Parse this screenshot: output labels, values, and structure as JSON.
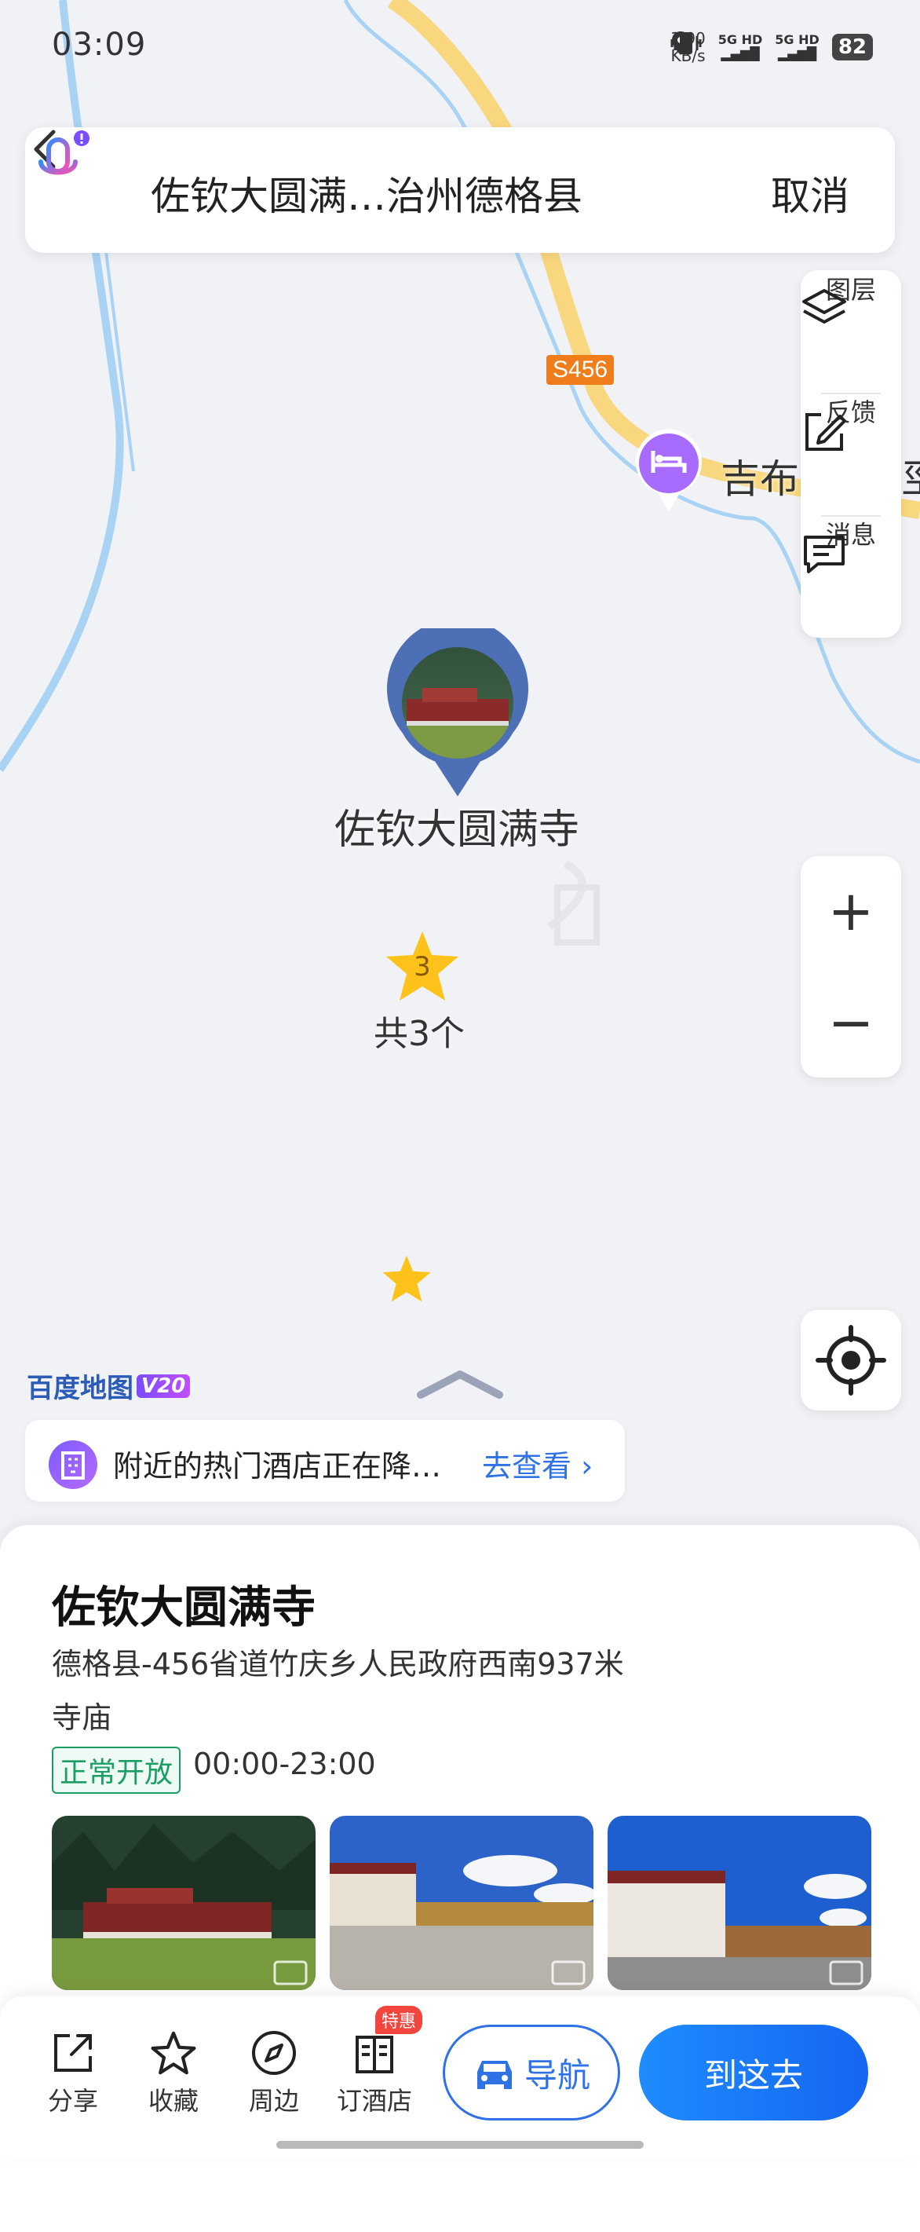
{
  "status_bar": {
    "time": "03:09",
    "net_speed_value": "3.90",
    "net_speed_unit": "KB/s",
    "sim1": "5G HD",
    "sim2": "5G HD",
    "battery": "82"
  },
  "search": {
    "query": "佐钦大圆满…治州德格县",
    "cancel_label": "取消"
  },
  "map_tools": {
    "layers_label": "图层",
    "feedback_label": "反馈",
    "messages_label": "消息",
    "zoom_in_label": "+",
    "zoom_out_label": "−"
  },
  "map": {
    "road_badge": "S456",
    "hotel_poi_label": "吉布",
    "hotel_poi_label_cut": "巠",
    "selected_poi_label": "佐钦大圆满寺",
    "cluster_count": "3",
    "cluster_label": "共3个",
    "logo_text": "百度地图",
    "logo_version": "V20"
  },
  "hotel_promo": {
    "text": "附近的热门酒店正在降…",
    "link": "去查看"
  },
  "place": {
    "title": "佐钦大圆满寺",
    "address": "德格县-456省道竹庆乡人民政府西南937米",
    "category": "寺庙",
    "open_status": "正常开放",
    "hours": "00:00-23:00"
  },
  "bottom_bar": {
    "share_label": "分享",
    "favorite_label": "收藏",
    "nearby_label": "周边",
    "book_hotel_label": "订酒店",
    "hot_tag": "特惠",
    "navigate_label": "导航",
    "go_label": "到这去"
  },
  "colors": {
    "accent": "#2e72e6",
    "open_green": "#1a9e64",
    "road_yellow": "#f9d77e",
    "river_blue": "#a9d3f5",
    "hotel_purple": "#a86bff"
  }
}
